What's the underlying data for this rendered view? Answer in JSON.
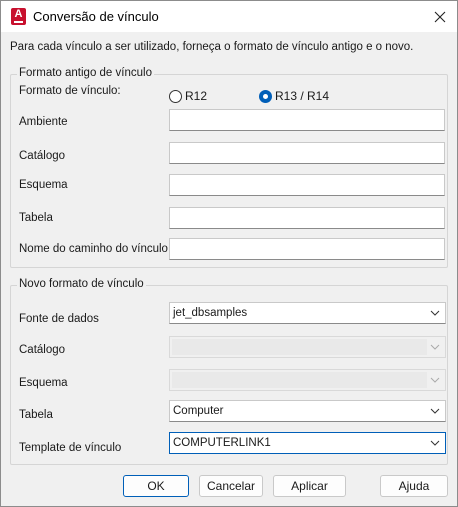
{
  "titlebar": {
    "title": "Conversão de vínculo",
    "app_icon_letter": "A"
  },
  "instruction": "Para cada vínculo a ser utilizado, forneça o formato de vínculo antigo e o novo.",
  "old_format": {
    "group_title": "Formato antigo de vínculo",
    "format_label": "Formato de vínculo:",
    "radio_r12": "R12",
    "radio_r13": "R13 / R14",
    "selected": "R13 / R14",
    "fields": {
      "environment": {
        "label": "Ambiente",
        "value": ""
      },
      "catalog": {
        "label": "Catálogo",
        "value": ""
      },
      "schema": {
        "label": "Esquema",
        "value": ""
      },
      "table": {
        "label": "Tabela",
        "value": ""
      },
      "path": {
        "label": "Nome do caminho do vínculo",
        "value": ""
      }
    }
  },
  "new_format": {
    "group_title": "Novo formato de vínculo",
    "datasource": {
      "label": "Fonte de dados",
      "value": "jet_dbsamples"
    },
    "catalog": {
      "label": "Catálogo",
      "value": ""
    },
    "schema": {
      "label": "Esquema",
      "value": ""
    },
    "table": {
      "label": "Tabela",
      "value": "Computer"
    },
    "template": {
      "label": "Template de vínculo",
      "value": "COMPUTERLINK1"
    }
  },
  "buttons": {
    "ok": "OK",
    "cancel": "Cancelar",
    "apply": "Aplicar",
    "help": "Ajuda"
  },
  "colors": {
    "accent": "#005fb8",
    "app_icon": "#c8102e"
  }
}
